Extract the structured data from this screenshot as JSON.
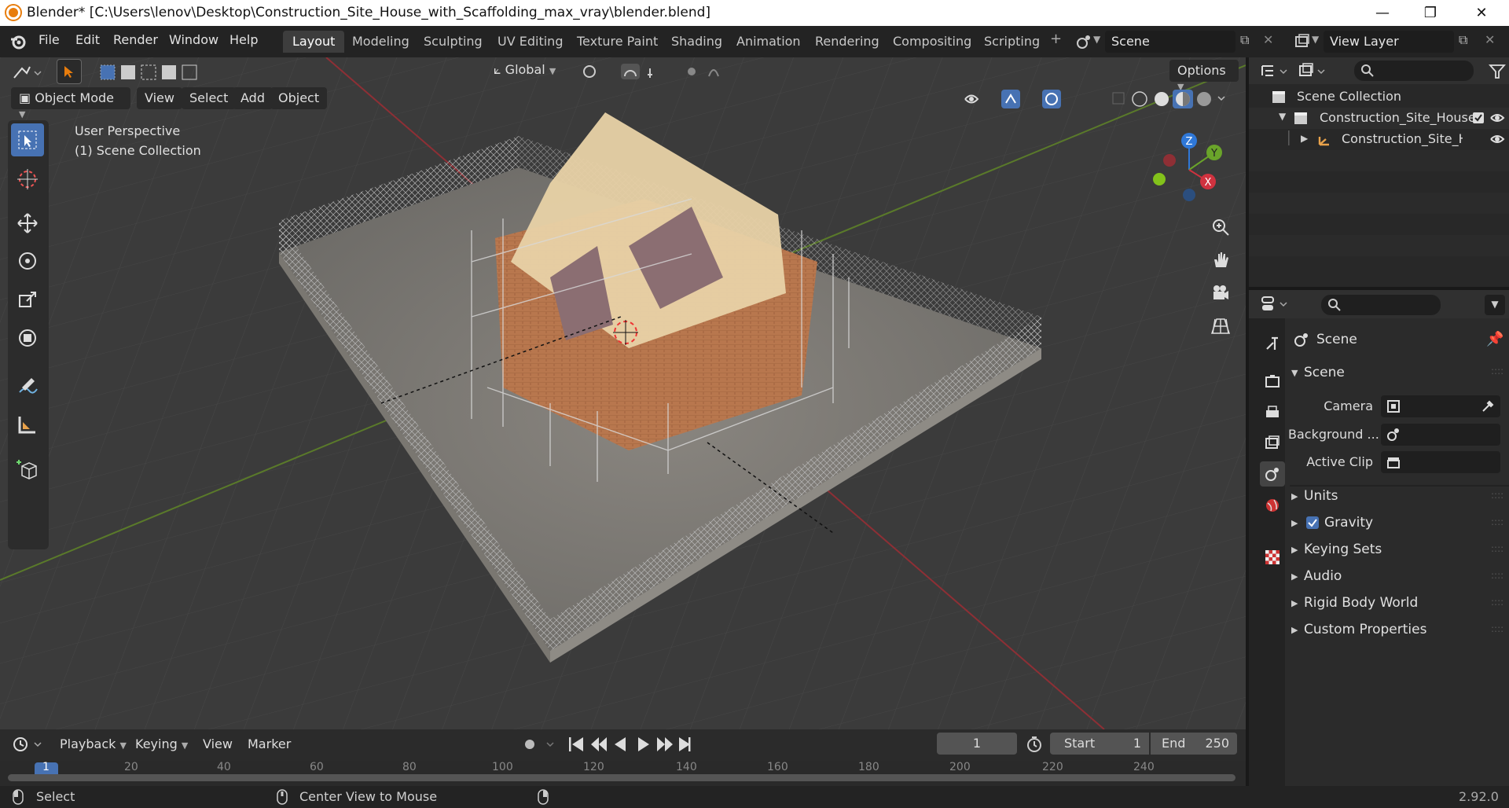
{
  "window": {
    "title": "Blender* [C:\\Users\\lenov\\Desktop\\Construction_Site_House_with_Scaffolding_max_vray\\blender.blend]",
    "minimize": "—",
    "restore": "❐",
    "close": "✕"
  },
  "menu": [
    "File",
    "Edit",
    "Render",
    "Window",
    "Help"
  ],
  "workspaces": [
    "Layout",
    "Modeling",
    "Sculpting",
    "UV Editing",
    "Texture Paint",
    "Shading",
    "Animation",
    "Rendering",
    "Compositing",
    "Scripting"
  ],
  "workspace_add": "+",
  "scene_field": "Scene",
  "view_layer_field": "View Layer",
  "viewport": {
    "transform_orientation": "Global",
    "options": "Options",
    "mode": "Object Mode",
    "header_menus": [
      "View",
      "Select",
      "Add",
      "Object"
    ],
    "overlay_line1": "User Perspective",
    "overlay_line2": "(1) Scene Collection",
    "gizmo": {
      "z": "Z",
      "y": "Y",
      "x": "X"
    }
  },
  "outliner": {
    "root": "Scene Collection",
    "collection": "Construction_Site_House",
    "object": "Construction_Site_Ho"
  },
  "properties": {
    "context": "Scene",
    "panel": "Scene",
    "camera_label": "Camera",
    "background_label": "Background ...",
    "active_clip_label": "Active Clip",
    "sections": [
      "Units",
      "Gravity",
      "Keying Sets",
      "Audio",
      "Rigid Body World",
      "Custom Properties"
    ],
    "gravity_checked": true
  },
  "timeline": {
    "menus": [
      "Playback",
      "Keying",
      "View",
      "Marker"
    ],
    "current_frame": "1",
    "start_label": "Start",
    "start": "1",
    "end_label": "End",
    "end": "250",
    "ruler": [
      "1",
      "20",
      "40",
      "60",
      "80",
      "100",
      "120",
      "140",
      "160",
      "180",
      "200",
      "220",
      "240"
    ]
  },
  "status": {
    "select": "Select",
    "center": "Center View to Mouse",
    "version": "2.92.0"
  },
  "colors": {
    "accent": "#4772b3",
    "x_axis": "#d0323f",
    "y_axis": "#6aa42a",
    "z_axis": "#2f78d8",
    "blender_orange": "#e87d0d"
  }
}
